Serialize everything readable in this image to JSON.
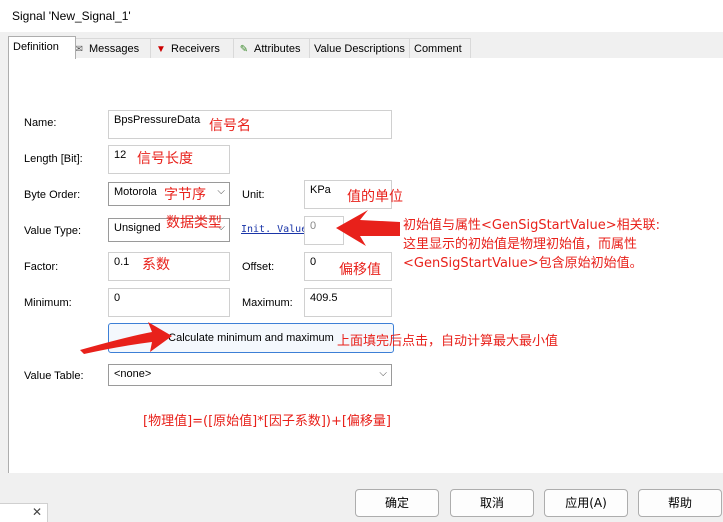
{
  "window": {
    "title": "Signal 'New_Signal_1'",
    "close_glyph": "✕"
  },
  "tabs": [
    {
      "label": "Definition",
      "icon": ""
    },
    {
      "label": "Messages",
      "icon": "envelope-icon"
    },
    {
      "label": "Receivers",
      "icon": "receiver-icon"
    },
    {
      "label": "Attributes",
      "icon": "pencil-icon"
    },
    {
      "label": "Value Descriptions",
      "icon": ""
    },
    {
      "label": "Comment",
      "icon": ""
    }
  ],
  "form": {
    "name_label": "Name:",
    "name_value": "BpsPressureData",
    "length_label": "Length [Bit]:",
    "length_value": "12",
    "byte_order_label": "Byte Order:",
    "byte_order_value": "Motorola",
    "unit_label": "Unit:",
    "unit_value": "KPa",
    "value_type_label": "Value Type:",
    "value_type_value": "Unsigned",
    "init_value_label": "Init. Value",
    "init_value": "0",
    "factor_label": "Factor:",
    "factor_value": "0.1",
    "offset_label": "Offset:",
    "offset_value": "0",
    "minimum_label": "Minimum:",
    "minimum_value": "0",
    "maximum_label": "Maximum:",
    "maximum_value": "409.5",
    "calc_button": "Calculate minimum and maximum",
    "value_table_label": "Value Table:",
    "value_table_value": "<none>"
  },
  "annotations": {
    "name": "信号名",
    "length": "信号长度",
    "byte_order": "字节序",
    "unit": "值的单位",
    "value_type": "数据类型",
    "factor": "系数",
    "offset": "偏移值",
    "init_note_1": "初始值与属性<GenSigStartValue>相关联:",
    "init_note_2": "这里显示的初始值是物理初始值，而属性",
    "init_note_3": "<GenSigStartValue>包含原始初始值。",
    "calc_note": "上面填完后点击，自动计算最大最小值",
    "formula": "[物理值]=([原始值]*[因子系数])+[偏移量]"
  },
  "buttons": {
    "ok": "确定",
    "cancel": "取消",
    "apply": "应用(A)",
    "help": "帮助"
  },
  "colors": {
    "annotation": "#e8211b",
    "link": "#1a35a8",
    "focus_border": "#3c7fd6"
  }
}
